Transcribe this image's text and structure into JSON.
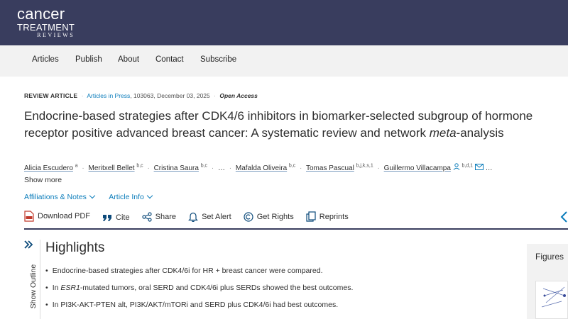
{
  "header": {
    "logo": {
      "line1": "cancer",
      "line2": "TREATMENT",
      "line3": "REVIEWS"
    },
    "nav": [
      "Articles",
      "Publish",
      "About",
      "Contact",
      "Subscribe"
    ],
    "bg_color": "#393d5e"
  },
  "article": {
    "type": "REVIEW ARTICLE",
    "in_press": "Articles in Press",
    "id_date": ", 103063, December 03, 2025",
    "open_access": "Open Access",
    "title_a": "Endocrine-based strategies after CDK4/6 inhibitors in biomarker-selected subgroup of hormone receptor positive advanced breast cancer: A systematic review and network ",
    "title_em": "meta",
    "title_b": "-analysis",
    "authors": [
      {
        "name": "Alicia Escudero",
        "aff": "a"
      },
      {
        "name": "Meritxell Bellet",
        "aff": "b,c"
      },
      {
        "name": "Cristina Saura",
        "aff": "b,c"
      },
      {
        "name": "…",
        "aff": ""
      },
      {
        "name": "Mafalda Oliveira",
        "aff": "b,c"
      },
      {
        "name": "Tomas Pascual",
        "aff": "b,j,k,s,1"
      },
      {
        "name": "Guillermo Villacampa",
        "aff": "b,d,1"
      }
    ],
    "show_more": "Show more",
    "affiliations": "Affiliations & Notes",
    "article_info": "Article Info",
    "accent_color": "#0c7dbb"
  },
  "toolbar": {
    "download_pdf": "Download PDF",
    "cite": "Cite",
    "share": "Share",
    "set_alert": "Set Alert",
    "get_rights": "Get Rights",
    "reprints": "Reprints"
  },
  "outline": {
    "label": "Show Outline"
  },
  "highlights": {
    "heading": "Highlights",
    "item1": "Endocrine-based strategies after CDK4/6i for HR + breast cancer were compared.",
    "item2_pre": "In ",
    "item2_em": "ESR1",
    "item2_post": "-mutated tumors, oral SERD and CDK4/6i plus SERDs showed the best outcomes.",
    "item3": "In PI3K-AKT-PTEN alt, PI3K/AKT/mTORi and SERD plus CDK4/6i had best outcomes."
  },
  "figures": {
    "label": "Figures"
  }
}
